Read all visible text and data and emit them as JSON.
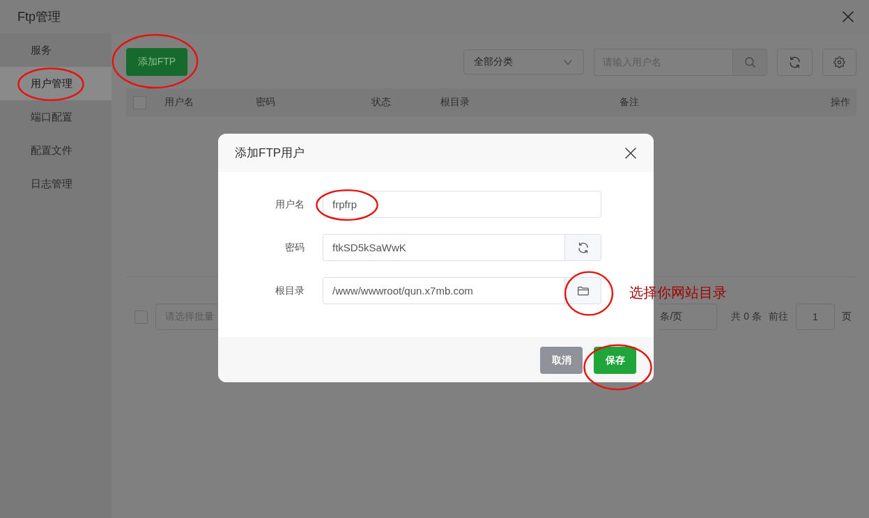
{
  "window": {
    "title": "Ftp管理"
  },
  "sidebar": {
    "items": [
      {
        "label": "服务",
        "selected": false,
        "highlighted": false
      },
      {
        "label": "用户管理",
        "selected": true,
        "highlighted": true
      },
      {
        "label": "端口配置",
        "selected": false,
        "highlighted": false
      },
      {
        "label": "配置文件",
        "selected": false,
        "highlighted": false
      },
      {
        "label": "日志管理",
        "selected": false,
        "highlighted": false
      }
    ]
  },
  "toolbar": {
    "add_button": {
      "label": "添加FTP",
      "highlighted": true
    },
    "category_select": {
      "value": "全部分类"
    },
    "search": {
      "placeholder": "请输入用户名"
    }
  },
  "table": {
    "select_all": {
      "checked": false
    },
    "columns": [
      "用户名",
      "密码",
      "状态",
      "根目录",
      "备注",
      "操作"
    ]
  },
  "footer": {
    "checkbox": {
      "checked": false
    },
    "batch_select": {
      "placeholder": "请选择批量"
    },
    "page_size": "条/页",
    "total": "共 0 条",
    "goto_label": "前往",
    "page_input": "1",
    "page_suffix": "页"
  },
  "dialog": {
    "title": "添加FTP用户",
    "fields": [
      {
        "kind": "text",
        "label": "用户名",
        "value": "frpfrp",
        "highlighted": true
      },
      {
        "kind": "refresh",
        "label": "密码",
        "value": "ftkSD5kSaWwK",
        "highlighted": false,
        "button_highlighted": false
      },
      {
        "kind": "folder",
        "label": "根目录",
        "value": "/www/wwwroot/qun.x7mb.com",
        "highlighted": false,
        "button_highlighted": true
      }
    ],
    "buttons": [
      {
        "kind": "cancel",
        "label": "取消",
        "highlighted": false
      },
      {
        "kind": "save",
        "label": "保存",
        "highlighted": true
      }
    ]
  },
  "annotation": {
    "text": "选择你网站目录"
  }
}
